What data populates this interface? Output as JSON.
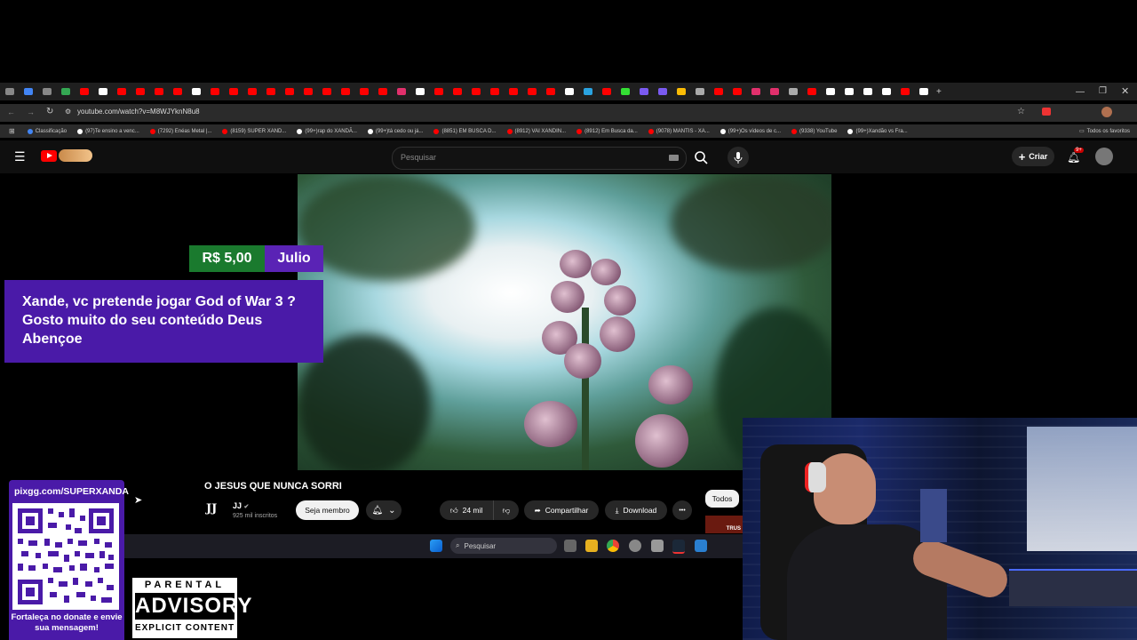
{
  "browser": {
    "url": "youtube.com/watch?v=M8WJYknN8u8",
    "bookmarks": [
      {
        "label": "Classificação",
        "color": "#4285f4"
      },
      {
        "label": "(97)Te ensino a venc...",
        "color": "#ffffff"
      },
      {
        "label": "(7292) Enéas Metal |...",
        "color": "#ff0000"
      },
      {
        "label": "(8159) SUPER XAND...",
        "color": "#ff0000"
      },
      {
        "label": "(99+)rap do XANDÃ...",
        "color": "#ffffff"
      },
      {
        "label": "(99+)tá cedo ou já...",
        "color": "#ffffff"
      },
      {
        "label": "(8851) EM BUSCA D...",
        "color": "#ff0000"
      },
      {
        "label": "(8912) VAI XANDIN...",
        "color": "#ff0000"
      },
      {
        "label": "(8912) Em Busca da...",
        "color": "#ff0000"
      },
      {
        "label": "(9078) MANTIS - XA...",
        "color": "#ff0000"
      },
      {
        "label": "(99+)Os vídeos de c...",
        "color": "#ffffff"
      },
      {
        "label": "(9338) YouTube",
        "color": "#ff0000"
      },
      {
        "label": "(99+)Xandão vs Fra...",
        "color": "#ffffff"
      }
    ],
    "all_favorites": "Todos os favoritos"
  },
  "youtube": {
    "search_placeholder": "Pesquisar",
    "create_label": "Criar",
    "notif_badge": "9+",
    "video_title": "O JESUS QUE NUNCA SORRI",
    "channel_logo": "JJ",
    "channel_name": "JJ",
    "subscribers": "925 mil inscritos",
    "member_label": "Seja membro",
    "likes": "24 mil",
    "share_label": "Compartilhar",
    "download_label": "Download",
    "more_label": "•••",
    "chip_all": "Todos",
    "side_thumb_text": "TRUS"
  },
  "donation": {
    "amount": "R$ 5,00",
    "name": "Julio",
    "message": "Xande, vc pretende jogar God of War 3 ? Gosto muito do seu conteúdo Deus Abençoe"
  },
  "taskbar": {
    "search_placeholder": "Pesquisar"
  },
  "overlay": {
    "qr_url": "pixgg.com/SUPERXANDA",
    "qr_caption": "Fortaleça no donate e envie sua mensagem!",
    "parental_top": "PARENTAL",
    "parental_mid": "ADVISORY",
    "parental_bot": "EXPLICIT CONTENT"
  }
}
